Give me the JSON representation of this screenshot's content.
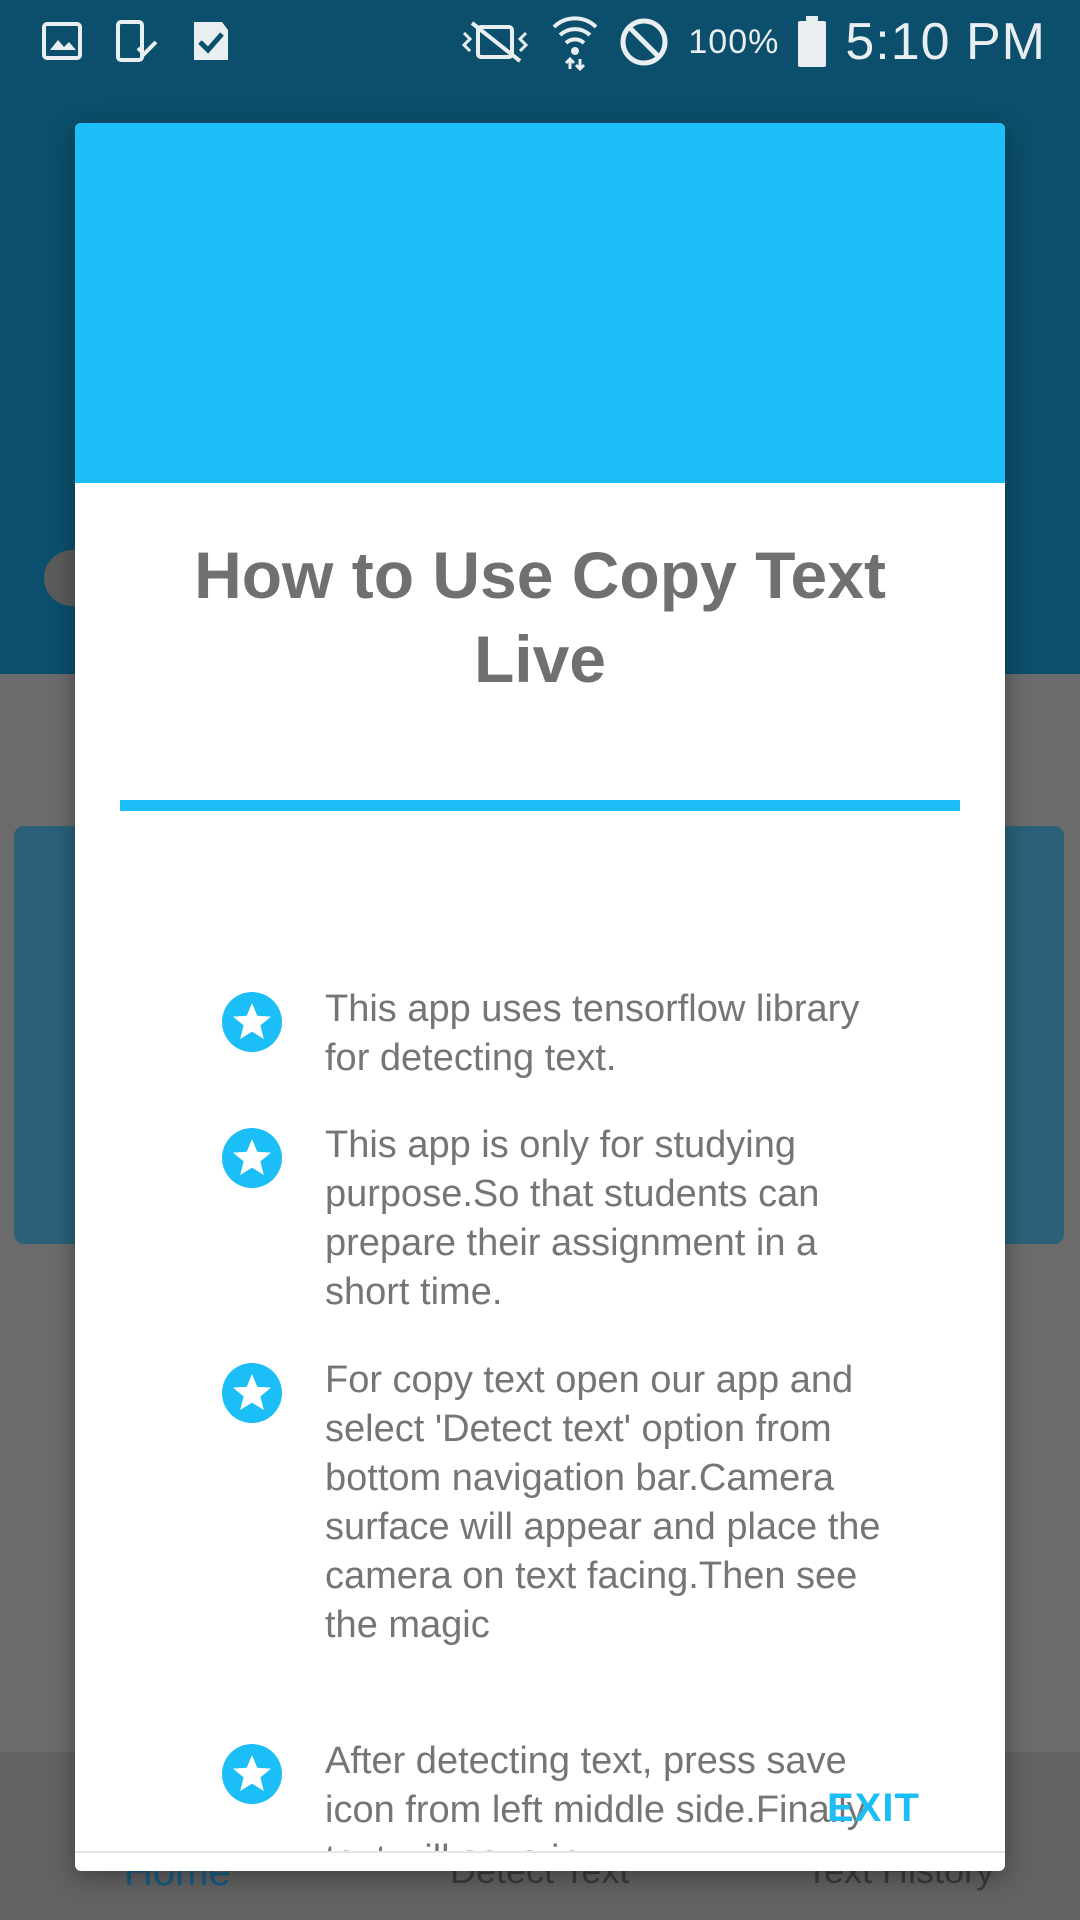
{
  "status_bar": {
    "left_icons": [
      "image-icon",
      "device-check-icon",
      "task-check-icon"
    ],
    "right_icons": [
      "vibrate-off-icon",
      "wifi-icon",
      "do-not-disturb-icon",
      "battery-icon"
    ],
    "battery_percent": "100%",
    "time": "5:10 PM"
  },
  "background_app": {
    "bottom_nav": {
      "items": [
        {
          "label": "Home"
        },
        {
          "label": "Detect Text"
        },
        {
          "label": "Text History"
        }
      ]
    }
  },
  "dialog": {
    "title": "How to Use Copy Text Live",
    "bullets": [
      {
        "icon": "star-icon",
        "text": "This app uses tensorflow library for detecting text."
      },
      {
        "icon": "star-icon",
        "text": "This app is only for studying purpose.So that students can prepare their assignment in a short time."
      },
      {
        "icon": "star-icon",
        "text": "For copy text open our app and select 'Detect text' option from bottom navigation bar.Camera surface will appear and place the camera on text facing.Then see the magic"
      },
      {
        "icon": "star-icon",
        "text": "After detecting text, press save icon from left middle side.Finally text will save in"
      }
    ],
    "exit_label": "EXIT"
  },
  "colors": {
    "accent": "#1bbef6",
    "appbar": "#0b4f6c",
    "title_text": "#707070",
    "body_text": "#757575"
  }
}
